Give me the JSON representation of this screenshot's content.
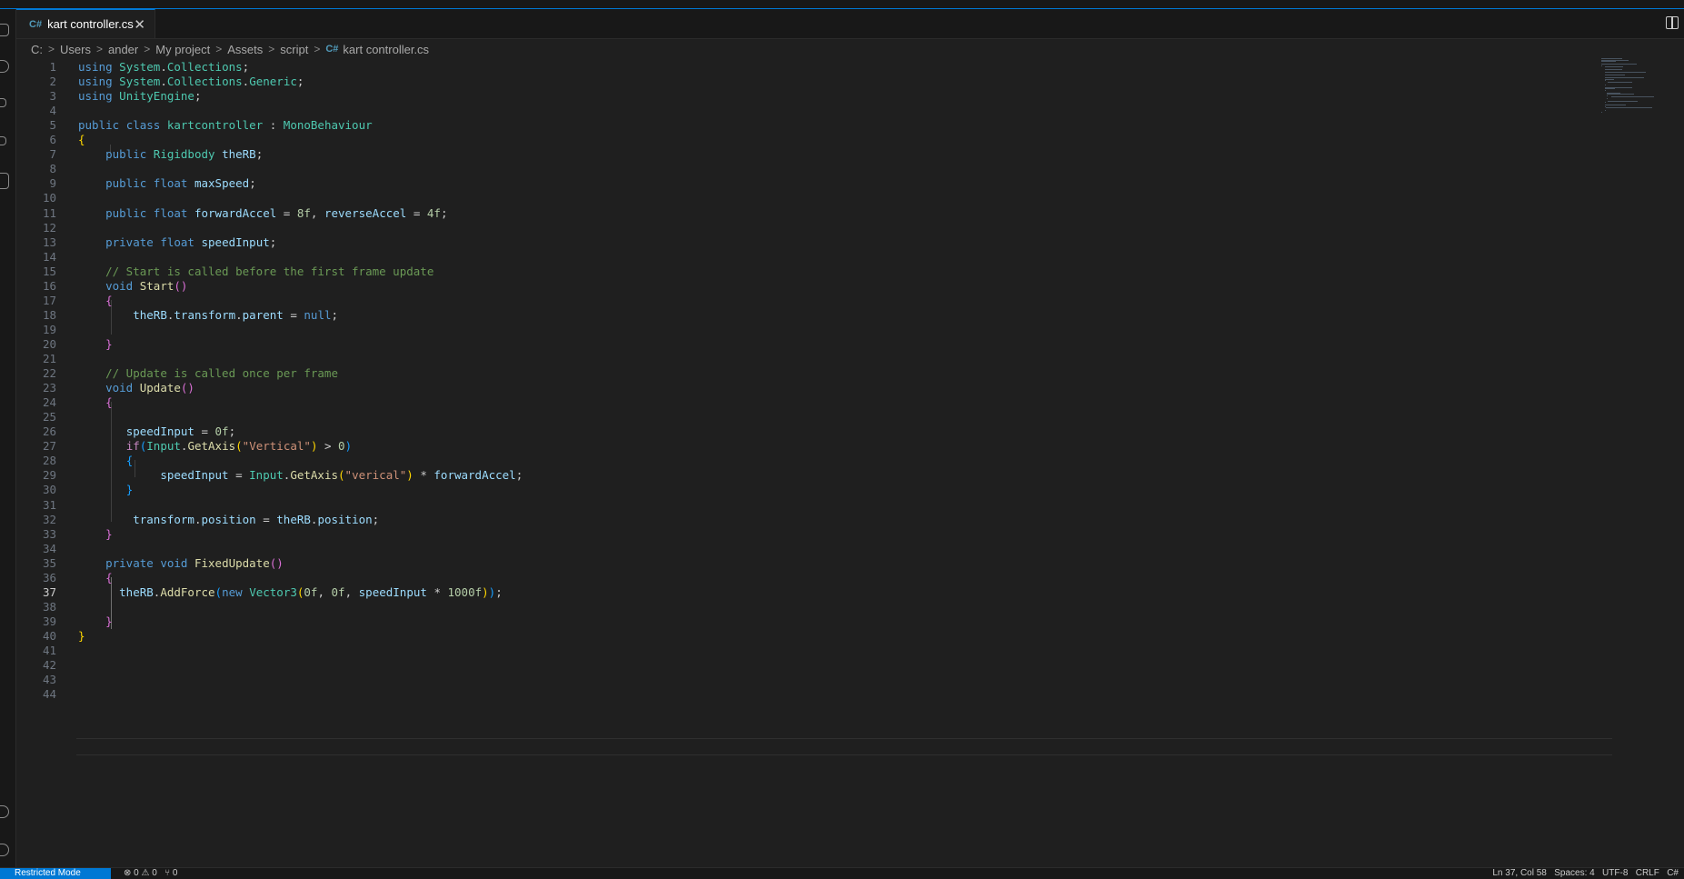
{
  "window": {
    "theme_accent": "#0078d4"
  },
  "tab": {
    "file_name": "kart controller.cs",
    "close_glyph": "✕",
    "icon": "csharp-icon"
  },
  "breadcrumb": {
    "items": [
      "C:",
      "Users",
      "ander",
      "My project",
      "Assets",
      "script"
    ],
    "file": "kart controller.cs"
  },
  "editor": {
    "active_line": 37,
    "lines": [
      [
        [
          "using",
          "kw"
        ],
        [
          " ",
          ""
        ],
        [
          "System",
          "ty"
        ],
        [
          ".",
          ""
        ],
        [
          "Collections",
          "ty"
        ],
        [
          ";",
          ""
        ]
      ],
      [
        [
          "using",
          "kw"
        ],
        [
          " ",
          ""
        ],
        [
          "System",
          "ty"
        ],
        [
          ".",
          ""
        ],
        [
          "Collections",
          "ty"
        ],
        [
          ".",
          ""
        ],
        [
          "Generic",
          "ty"
        ],
        [
          ";",
          ""
        ]
      ],
      [
        [
          "using",
          "kw"
        ],
        [
          " ",
          ""
        ],
        [
          "UnityEngine",
          "ty"
        ],
        [
          ";",
          ""
        ]
      ],
      [],
      [
        [
          "public",
          "kw"
        ],
        [
          " ",
          ""
        ],
        [
          "class",
          "kw"
        ],
        [
          " ",
          ""
        ],
        [
          "kartcontroller",
          "ty"
        ],
        [
          " : ",
          ""
        ],
        [
          "MonoBehaviour",
          "ty"
        ]
      ],
      [
        [
          "{",
          "p1"
        ]
      ],
      [
        [
          "    ",
          ""
        ],
        [
          "public",
          "kw"
        ],
        [
          " ",
          ""
        ],
        [
          "Rigidbody",
          "ty"
        ],
        [
          " ",
          ""
        ],
        [
          "theRB",
          "va"
        ],
        [
          ";",
          ""
        ]
      ],
      [],
      [
        [
          "    ",
          ""
        ],
        [
          "public",
          "kw"
        ],
        [
          " ",
          ""
        ],
        [
          "float",
          "kw"
        ],
        [
          " ",
          ""
        ],
        [
          "maxSpeed",
          "va"
        ],
        [
          ";",
          ""
        ]
      ],
      [],
      [
        [
          "    ",
          ""
        ],
        [
          "public",
          "kw"
        ],
        [
          " ",
          ""
        ],
        [
          "float",
          "kw"
        ],
        [
          " ",
          ""
        ],
        [
          "forwardAccel",
          "va"
        ],
        [
          " = ",
          ""
        ],
        [
          "8f",
          "num"
        ],
        [
          ", ",
          ""
        ],
        [
          "reverseAccel",
          "va"
        ],
        [
          " = ",
          ""
        ],
        [
          "4f",
          "num"
        ],
        [
          ";",
          ""
        ]
      ],
      [],
      [
        [
          "    ",
          ""
        ],
        [
          "private",
          "kw"
        ],
        [
          " ",
          ""
        ],
        [
          "float",
          "kw"
        ],
        [
          " ",
          ""
        ],
        [
          "speedInput",
          "va"
        ],
        [
          ";",
          ""
        ]
      ],
      [],
      [
        [
          "    ",
          ""
        ],
        [
          "// Start is called before the first frame update",
          "cm"
        ]
      ],
      [
        [
          "    ",
          ""
        ],
        [
          "void",
          "kw"
        ],
        [
          " ",
          ""
        ],
        [
          "Start",
          "fn"
        ],
        [
          "()",
          "p2"
        ]
      ],
      [
        [
          "    ",
          ""
        ],
        [
          "{",
          "p2"
        ]
      ],
      [
        [
          "        ",
          ""
        ],
        [
          "theRB",
          "va"
        ],
        [
          ".",
          ""
        ],
        [
          "transform",
          "va"
        ],
        [
          ".",
          ""
        ],
        [
          "parent",
          "va"
        ],
        [
          " = ",
          ""
        ],
        [
          "null",
          "kw"
        ],
        [
          ";",
          ""
        ]
      ],
      [],
      [
        [
          "    ",
          ""
        ],
        [
          "}",
          "p2"
        ]
      ],
      [],
      [
        [
          "    ",
          ""
        ],
        [
          "// Update is called once per frame",
          "cm"
        ]
      ],
      [
        [
          "    ",
          ""
        ],
        [
          "void",
          "kw"
        ],
        [
          " ",
          ""
        ],
        [
          "Update",
          "fn"
        ],
        [
          "()",
          "p2"
        ]
      ],
      [
        [
          "    ",
          ""
        ],
        [
          "{",
          "p2"
        ]
      ],
      [],
      [
        [
          "       ",
          ""
        ],
        [
          "speedInput",
          "va"
        ],
        [
          " = ",
          ""
        ],
        [
          "0f",
          "num"
        ],
        [
          ";",
          ""
        ]
      ],
      [
        [
          "       ",
          ""
        ],
        [
          "if",
          "ctrl"
        ],
        [
          "(",
          "p3"
        ],
        [
          "Input",
          "ty"
        ],
        [
          ".",
          ""
        ],
        [
          "GetAxis",
          "fn"
        ],
        [
          "(",
          "p1"
        ],
        [
          "\"Vertical\"",
          "str"
        ],
        [
          ")",
          "p1"
        ],
        [
          " > ",
          ""
        ],
        [
          "0",
          "num"
        ],
        [
          ")",
          "p3"
        ]
      ],
      [
        [
          "       ",
          ""
        ],
        [
          "{",
          "p3"
        ]
      ],
      [
        [
          "            ",
          ""
        ],
        [
          "speedInput",
          "va"
        ],
        [
          " = ",
          ""
        ],
        [
          "Input",
          "ty"
        ],
        [
          ".",
          ""
        ],
        [
          "GetAxis",
          "fn"
        ],
        [
          "(",
          "p1"
        ],
        [
          "\"verical\"",
          "str"
        ],
        [
          ")",
          "p1"
        ],
        [
          " * ",
          ""
        ],
        [
          "forwardAccel",
          "va"
        ],
        [
          ";",
          ""
        ]
      ],
      [
        [
          "       ",
          ""
        ],
        [
          "}",
          "p3"
        ]
      ],
      [],
      [
        [
          "        ",
          ""
        ],
        [
          "transform",
          "va"
        ],
        [
          ".",
          ""
        ],
        [
          "position",
          "va"
        ],
        [
          " = ",
          ""
        ],
        [
          "theRB",
          "va"
        ],
        [
          ".",
          ""
        ],
        [
          "position",
          "va"
        ],
        [
          ";",
          ""
        ]
      ],
      [
        [
          "    ",
          ""
        ],
        [
          "}",
          "p2"
        ]
      ],
      [],
      [
        [
          "    ",
          ""
        ],
        [
          "private",
          "kw"
        ],
        [
          " ",
          ""
        ],
        [
          "void",
          "kw"
        ],
        [
          " ",
          ""
        ],
        [
          "FixedUpdate",
          "fn"
        ],
        [
          "()",
          "p2"
        ]
      ],
      [
        [
          "    ",
          ""
        ],
        [
          "{",
          "p2"
        ]
      ],
      [
        [
          "      ",
          ""
        ],
        [
          "theRB",
          "va"
        ],
        [
          ".",
          ""
        ],
        [
          "AddForce",
          "fn"
        ],
        [
          "(",
          "p3"
        ],
        [
          "new",
          "kw"
        ],
        [
          " ",
          ""
        ],
        [
          "Vector3",
          "ty"
        ],
        [
          "(",
          "p1"
        ],
        [
          "0f",
          "num"
        ],
        [
          ", ",
          ""
        ],
        [
          "0f",
          "num"
        ],
        [
          ", ",
          ""
        ],
        [
          "speedInput",
          "va"
        ],
        [
          " * ",
          ""
        ],
        [
          "1000f",
          "num"
        ],
        [
          ")",
          "p1"
        ],
        [
          ")",
          "p3"
        ],
        [
          ";",
          ""
        ]
      ],
      [],
      [
        [
          "    ",
          ""
        ],
        [
          "}",
          "p2"
        ]
      ],
      [
        [
          "}",
          "p1"
        ]
      ],
      [],
      [],
      [],
      []
    ]
  },
  "statusbar": {
    "remote_label": "Restricted Mode",
    "problems": "⊗ 0 ⚠ 0",
    "ports": "⑂ 0",
    "position": "Ln 37, Col 58",
    "spaces": "Spaces: 4",
    "encoding": "UTF-8",
    "eol": "CRLF",
    "language": "C#"
  },
  "activity_icons": [
    "explorer-icon",
    "search-icon",
    "source-control-icon",
    "run-debug-icon",
    "extensions-icon",
    "account-icon",
    "settings-icon"
  ]
}
